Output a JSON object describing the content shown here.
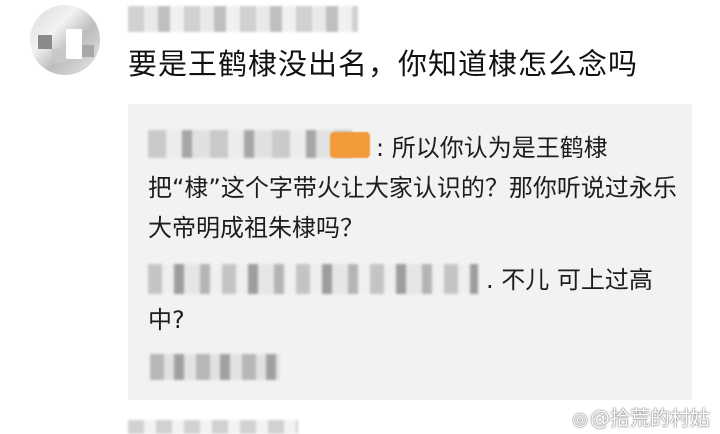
{
  "comment": {
    "text": "要是王鹤棣没出名，你知道棣怎么念吗"
  },
  "reply": {
    "text": ": 所以你认为是王鹤棣把“棣”这个字带火让大家认识的？那你听说过永乐大帝明成祖朱棣吗？"
  },
  "second_reply": {
    "text": ". 不儿 可上过高中?"
  },
  "watermark": {
    "icon": "weibo-icon",
    "text": "@拾荒的村姑"
  },
  "colors": {
    "reply_background": "#f2f2f2",
    "badge_orange": "#f39a3a"
  }
}
